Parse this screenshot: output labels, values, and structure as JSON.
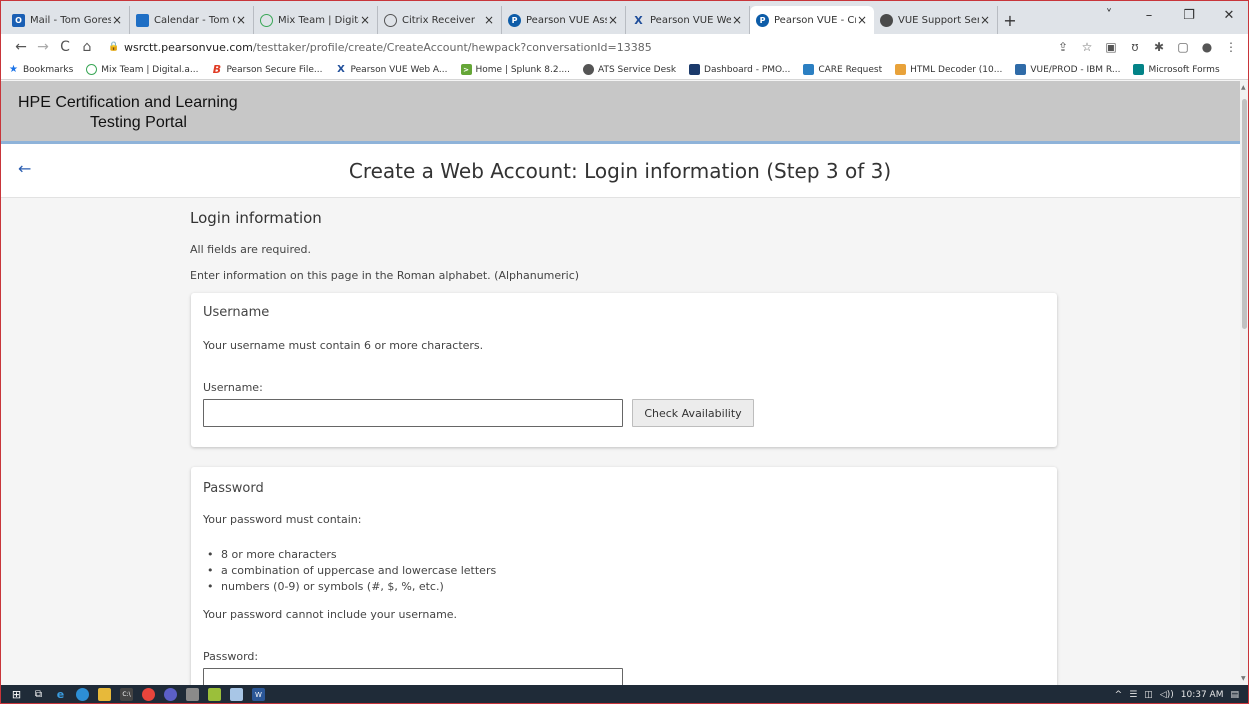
{
  "browser": {
    "tabs": [
      {
        "title": "Mail - Tom Gores -",
        "icon": "outlook-icon",
        "color": "#1a5fb4",
        "letter": "O"
      },
      {
        "title": "Calendar - Tom Go",
        "icon": "calendar-icon",
        "color": "#1f6fc5",
        "letter": ""
      },
      {
        "title": "Mix Team | Digital.",
        "icon": "mix-icon",
        "color": "#ffffff",
        "letter": ""
      },
      {
        "title": "Citrix Receiver",
        "icon": "citrix-icon",
        "color": "#ffffff",
        "letter": ""
      },
      {
        "title": "Pearson VUE Assist",
        "icon": "pearson-icon",
        "color": "#0d5ca8",
        "letter": "P"
      },
      {
        "title": "Pearson VUE Web",
        "icon": "vue-icon",
        "color": "#ffffff",
        "letter": "X"
      },
      {
        "title": "Pearson VUE - Cre",
        "icon": "pearson-icon",
        "color": "#0d5ca8",
        "letter": "P",
        "active": true
      },
      {
        "title": "VUE Support Servi",
        "icon": "globe-icon",
        "color": "#4a4a4a",
        "letter": ""
      }
    ],
    "new_tab": "+",
    "window_controls": {
      "list": "˅",
      "minimize": "–",
      "maximize": "❐",
      "close": "✕"
    },
    "url_host": "wsrctt.pearsonvue.com",
    "url_path": "/testtaker/profile/create/CreateAccount/hewpack?conversationId=13385",
    "bookmarks": [
      {
        "label": "Bookmarks",
        "icon": "star-icon",
        "color": "#1a73e8"
      },
      {
        "label": "Mix Team | Digital.a...",
        "icon": "mix-icon",
        "color": "#3aa757"
      },
      {
        "label": "Pearson Secure File...",
        "icon": "pearson-b-icon",
        "color": "#e03b24"
      },
      {
        "label": "Pearson VUE Web A...",
        "icon": "vue-icon",
        "color": "#1f4e9a"
      },
      {
        "label": "Home | Splunk 8.2....",
        "icon": "splunk-icon",
        "color": "#65a637"
      },
      {
        "label": "ATS Service Desk",
        "icon": "globe-icon",
        "color": "#555555"
      },
      {
        "label": "Dashboard - PMO...",
        "icon": "dashboard-icon",
        "color": "#1b3a6b"
      },
      {
        "label": "CARE Request",
        "icon": "sharepoint-icon",
        "color": "#2b7fc2"
      },
      {
        "label": "HTML Decoder (10...",
        "icon": "decoder-icon",
        "color": "#e8a23a"
      },
      {
        "label": "VUE/PROD - IBM R...",
        "icon": "ibm-icon",
        "color": "#2f6ba8"
      },
      {
        "label": "Microsoft Forms",
        "icon": "forms-icon",
        "color": "#038387"
      }
    ]
  },
  "header": {
    "line1": "HPE Certification and Learning",
    "line2": "Testing Portal"
  },
  "page": {
    "title": "Create a Web Account: Login information (Step 3 of 3)"
  },
  "login": {
    "heading": "Login information",
    "required_note": "All fields are required.",
    "alphabet_note": "Enter information on this page in the Roman alphabet. (Alphanumeric)"
  },
  "username": {
    "title": "Username",
    "rule": "Your username must contain 6 or more characters.",
    "label": "Username:",
    "value": "",
    "check_button": "Check Availability"
  },
  "password": {
    "title": "Password",
    "intro": "Your password must contain:",
    "rules": [
      "8 or more characters",
      "a combination of uppercase and lowercase letters",
      "numbers (0-9) or symbols (#, $, %, etc.)"
    ],
    "exclusion": "Your password cannot include your username.",
    "label": "Password:"
  },
  "taskbar": {
    "clock": "10:37 AM",
    "tray": [
      "^",
      "☰",
      "◫",
      "◁))"
    ]
  }
}
